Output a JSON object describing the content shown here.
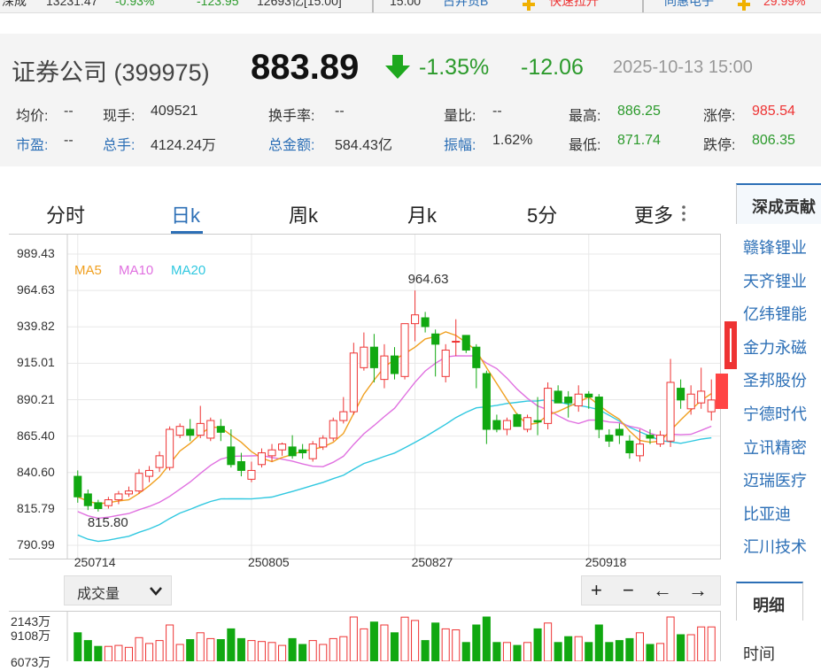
{
  "ticker_bar": [
    {
      "text": "深成",
      "color": "#333"
    },
    {
      "text": "13231.47",
      "color": "#333"
    },
    {
      "text": "-0.93%",
      "color": "#2b9a2b"
    },
    {
      "text": "-123.95",
      "color": "#2b9a2b"
    },
    {
      "text": "12693亿[15:00]",
      "color": "#333"
    },
    {
      "text": "15:00",
      "color": "#333"
    },
    {
      "text": "古井贡B",
      "color": "#2c6fb6"
    },
    {
      "text": "快速拉升",
      "color": "#e33"
    },
    {
      "text": "同惠电子",
      "color": "#2c6fb6"
    },
    {
      "text": "29.99%",
      "color": "#e33"
    }
  ],
  "quote": {
    "name": "证券公司 (399975)",
    "price": "883.89",
    "pct": "-1.35%",
    "change": "-12.06",
    "datetime": "2025-10-13 15:00"
  },
  "stats_row1": [
    {
      "label": "均价:",
      "value": "--",
      "label_color": "#333",
      "value_color": "#333"
    },
    {
      "label": "现手:",
      "value": "409521",
      "label_color": "#333",
      "value_color": "#333"
    },
    {
      "label": "换手率:",
      "value": "--",
      "label_color": "#333",
      "value_color": "#333"
    },
    {
      "label": "量比:",
      "value": "--",
      "label_color": "#333",
      "value_color": "#333"
    },
    {
      "label": "最高:",
      "value": "886.25",
      "label_color": "#333",
      "value_color": "#2b9a2b"
    },
    {
      "label": "涨停:",
      "value": "985.54",
      "label_color": "#333",
      "value_color": "#e33"
    }
  ],
  "stats_row2": [
    {
      "label": "市盈:",
      "value": "--",
      "label_color": "#2c6fb6",
      "value_color": "#333"
    },
    {
      "label": "总手:",
      "value": "4124.24万",
      "label_color": "#2c6fb6",
      "value_color": "#333"
    },
    {
      "label": "总金额:",
      "value": "584.43亿",
      "label_color": "#2c6fb6",
      "value_color": "#333"
    },
    {
      "label": "振幅:",
      "value": "1.62%",
      "label_color": "#2c6fb6",
      "value_color": "#333"
    },
    {
      "label": "最低:",
      "value": "871.74",
      "label_color": "#333",
      "value_color": "#2b9a2b"
    },
    {
      "label": "跌停:",
      "value": "806.35",
      "label_color": "#333",
      "value_color": "#2b9a2b"
    }
  ],
  "tabs": [
    "分时",
    "日k",
    "周k",
    "月k",
    "5分",
    "更多"
  ],
  "active_tab": 1,
  "right_panel": {
    "header": "深成贡献",
    "stocks": [
      "赣锋锂业",
      "天齐锂业",
      "亿纬锂能",
      "金力永磁",
      "圣邦股份",
      "宁德时代",
      "立讯精密",
      "迈瑞医疗",
      "比亚迪",
      "汇川技术"
    ],
    "detail_tab": "明细",
    "time_label": "时间"
  },
  "volume": {
    "select_label": "成交量",
    "axis_labels": [
      "2143万",
      "9108万",
      "6073万"
    ]
  },
  "controls": [
    "+",
    "−",
    "←",
    "→"
  ],
  "colors": {
    "up": "#e33",
    "down": "#11a811",
    "ma5": "#f0a020",
    "ma10": "#e070e0",
    "ma20": "#30c8e0",
    "accent": "#2c6fb6"
  },
  "chart_data": {
    "type": "candlestick",
    "legend": [
      "MA5",
      "MA10",
      "MA20"
    ],
    "y_ticks": [
      "989.43",
      "964.63",
      "939.82",
      "915.01",
      "890.21",
      "865.40",
      "840.60",
      "815.79",
      "790.99"
    ],
    "ylim": [
      790.99,
      989.43
    ],
    "x_ticks": [
      {
        "label": "250714",
        "index": 0
      },
      {
        "label": "250805",
        "index": 17
      },
      {
        "label": "250827",
        "index": 33
      },
      {
        "label": "250918",
        "index": 50
      }
    ],
    "annotations": [
      {
        "text": "964.63",
        "index": 33,
        "value": 964.63
      },
      {
        "text": "815.80",
        "index": 2,
        "value": 815.8
      }
    ],
    "candles": [
      [
        838,
        824,
        842,
        820
      ],
      [
        826,
        818,
        829,
        815
      ],
      [
        820,
        816,
        822,
        814
      ],
      [
        818,
        822,
        824,
        816
      ],
      [
        822,
        826,
        828,
        819
      ],
      [
        826,
        828,
        831,
        824
      ],
      [
        828,
        840,
        843,
        826
      ],
      [
        838,
        842,
        845,
        834
      ],
      [
        844,
        852,
        855,
        841
      ],
      [
        844,
        870,
        872,
        842
      ],
      [
        866,
        872,
        874,
        864
      ],
      [
        870,
        866,
        877,
        862
      ],
      [
        866,
        874,
        886,
        864
      ],
      [
        864,
        876,
        878,
        862
      ],
      [
        872,
        868,
        877,
        862
      ],
      [
        858,
        846,
        870,
        844
      ],
      [
        848,
        842,
        854,
        838
      ],
      [
        836,
        842,
        848,
        834
      ],
      [
        846,
        854,
        857,
        844
      ],
      [
        852,
        856,
        860,
        848
      ],
      [
        856,
        860,
        861,
        852
      ],
      [
        858,
        852,
        866,
        850
      ],
      [
        856,
        854,
        860,
        850
      ],
      [
        850,
        860,
        862,
        848
      ],
      [
        858,
        864,
        866,
        856
      ],
      [
        864,
        876,
        878,
        862
      ],
      [
        876,
        882,
        892,
        874
      ],
      [
        882,
        922,
        929,
        880
      ],
      [
        912,
        926,
        936,
        910
      ],
      [
        926,
        912,
        935,
        902
      ],
      [
        904,
        920,
        928,
        898
      ],
      [
        920,
        908,
        926,
        904
      ],
      [
        906,
        942,
        942,
        904
      ],
      [
        942,
        948,
        964.63,
        930
      ],
      [
        946,
        940,
        950,
        936
      ],
      [
        935,
        928,
        938,
        906
      ],
      [
        906,
        924,
        928,
        902
      ],
      [
        930,
        930,
        945,
        920
      ],
      [
        934,
        924,
        934,
        922
      ],
      [
        926,
        912,
        928,
        898
      ],
      [
        908,
        870,
        910,
        860
      ],
      [
        876,
        870,
        880,
        868
      ],
      [
        870,
        876,
        878,
        866
      ],
      [
        880,
        872,
        881,
        872
      ],
      [
        870,
        878,
        880,
        868
      ],
      [
        876,
        875,
        892,
        866
      ],
      [
        874,
        898,
        902,
        870
      ],
      [
        896,
        888,
        900,
        888
      ],
      [
        892,
        888,
        896,
        878
      ],
      [
        886,
        894,
        900,
        882
      ],
      [
        894,
        892,
        896,
        884
      ],
      [
        892,
        870,
        894,
        864
      ],
      [
        866,
        862,
        870,
        858
      ],
      [
        870,
        866,
        874,
        860
      ],
      [
        862,
        854,
        866,
        850
      ],
      [
        852,
        860,
        870,
        848
      ],
      [
        866,
        864,
        870,
        860
      ],
      [
        860,
        866,
        869,
        858
      ],
      [
        862,
        902,
        918,
        858
      ],
      [
        898,
        890,
        904,
        884
      ],
      [
        884,
        894,
        900,
        880
      ],
      [
        888,
        896,
        912,
        884
      ],
      [
        882,
        890,
        904,
        876
      ]
    ]
  }
}
